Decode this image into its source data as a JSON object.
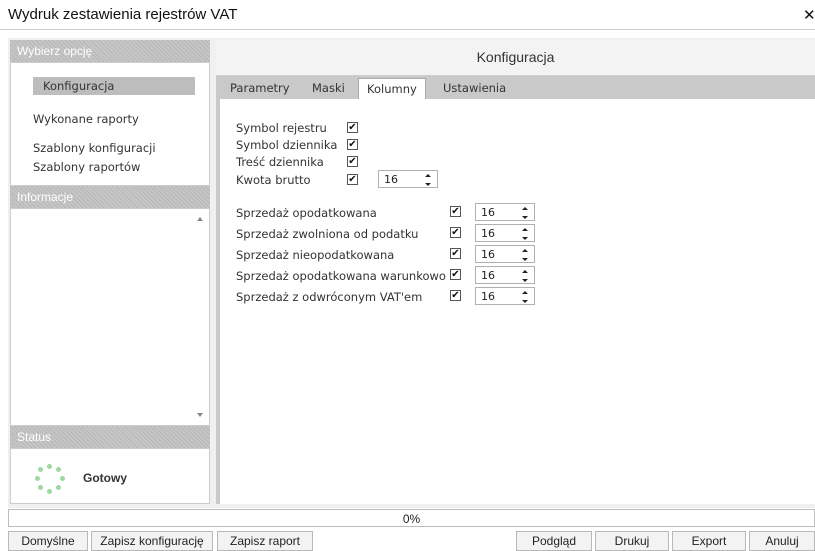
{
  "window": {
    "title": "Wydruk zestawienia rejestrów VAT"
  },
  "sidebar": {
    "options_header": "Wybierz opcję",
    "items": [
      {
        "label": "Konfiguracja",
        "active": true
      },
      {
        "label": "Wykonane raporty",
        "active": false
      },
      {
        "label": "Szablony konfiguracji",
        "active": false
      },
      {
        "label": "Szablony raportów",
        "active": false
      }
    ],
    "info_header": "Informacje",
    "status_header": "Status",
    "status_text": "Gotowy"
  },
  "main": {
    "title": "Konfiguracja",
    "tabs": [
      {
        "label": "Parametry",
        "active": false
      },
      {
        "label": "Maski",
        "active": false
      },
      {
        "label": "Kolumny",
        "active": true
      },
      {
        "label": "Ustawienia",
        "active": false
      }
    ],
    "group1": [
      {
        "label": "Symbol rejestru",
        "checked": true
      },
      {
        "label": "Symbol dziennika",
        "checked": true
      },
      {
        "label": "Treść dziennika",
        "checked": true
      },
      {
        "label": "Kwota brutto",
        "checked": true,
        "width": "16"
      }
    ],
    "group2": [
      {
        "label": "Sprzedaż opodatkowana",
        "checked": true,
        "width": "16"
      },
      {
        "label": "Sprzedaż zwolniona od podatku",
        "checked": true,
        "width": "16"
      },
      {
        "label": "Sprzedaż nieopodatkowana",
        "checked": true,
        "width": "16"
      },
      {
        "label": "Sprzedaż opodatkowana warunkowo",
        "checked": true,
        "width": "16"
      },
      {
        "label": "Sprzedaż z odwróconym VAT'em",
        "checked": true,
        "width": "16"
      }
    ]
  },
  "progress": {
    "value": 0,
    "label": "0%"
  },
  "buttons": {
    "defaults": "Domyślne",
    "save_config": "Zapisz konfigurację",
    "save_report": "Zapisz raport",
    "preview": "Podgląd",
    "print": "Drukuj",
    "export": "Export",
    "cancel": "Anuluj"
  },
  "colors": {
    "accent_green": "#7cc67d",
    "header_gray": "#bdbdbd"
  },
  "icons": {
    "close": "close-icon",
    "status": "loading-spinner-icon",
    "check": "checkmark-icon"
  }
}
